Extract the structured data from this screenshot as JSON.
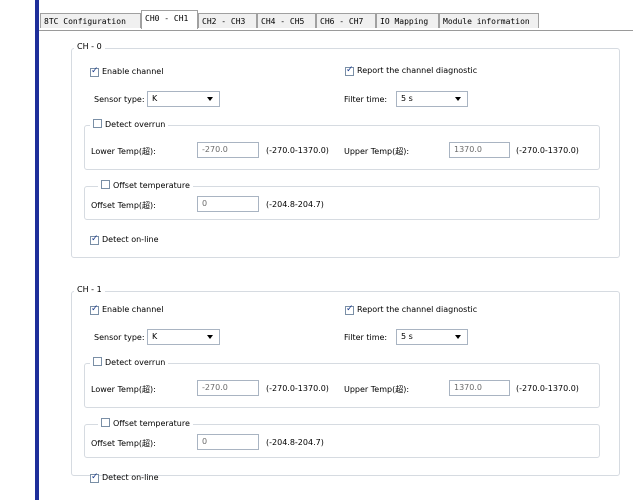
{
  "tabs": [
    {
      "label": "8TC Configuration"
    },
    {
      "label": "CH0 - CH1"
    },
    {
      "label": "CH2 - CH3"
    },
    {
      "label": "CH4 - CH5"
    },
    {
      "label": "CH6 - CH7"
    },
    {
      "label": "IO Mapping"
    },
    {
      "label": "Module information"
    }
  ],
  "active_tab": "CH0 - CH1",
  "channels": [
    {
      "title": "CH - 0",
      "enable_label": "Enable channel",
      "enable_checked": true,
      "report_label": "Report the channel diagnostic",
      "report_checked": true,
      "sensor_label": "Sensor type:",
      "sensor_value": "K",
      "filter_label": "Filter time:",
      "filter_value": "5 s",
      "overrun_label": "Detect overrun",
      "overrun_checked": false,
      "lower_label": "Lower Temp(超):",
      "lower_value": "-270.0",
      "lower_range": "(-270.0-1370.0)",
      "upper_label": "Upper Temp(超):",
      "upper_value": "1370.0",
      "upper_range": "(-270.0-1370.0)",
      "offset_group_label": "Offset temperature",
      "offset_checked": false,
      "offset_label": "Offset Temp(超):",
      "offset_value": "0",
      "offset_range": "(-204.8-204.7)",
      "online_label": "Detect on-line",
      "online_checked": true
    },
    {
      "title": "CH - 1",
      "enable_label": "Enable channel",
      "enable_checked": true,
      "report_label": "Report the channel diagnostic",
      "report_checked": true,
      "sensor_label": "Sensor type:",
      "sensor_value": "K",
      "filter_label": "Filter time:",
      "filter_value": "5 s",
      "overrun_label": "Detect overrun",
      "overrun_checked": false,
      "lower_label": "Lower Temp(超):",
      "lower_value": "-270.0",
      "lower_range": "(-270.0-1370.0)",
      "upper_label": "Upper Temp(超):",
      "upper_value": "1370.0",
      "upper_range": "(-270.0-1370.0)",
      "offset_group_label": "Offset temperature",
      "offset_checked": false,
      "offset_label": "Offset Temp(超):",
      "offset_value": "0",
      "offset_range": "(-204.8-204.7)",
      "online_label": "Detect on-line",
      "online_checked": true
    }
  ]
}
